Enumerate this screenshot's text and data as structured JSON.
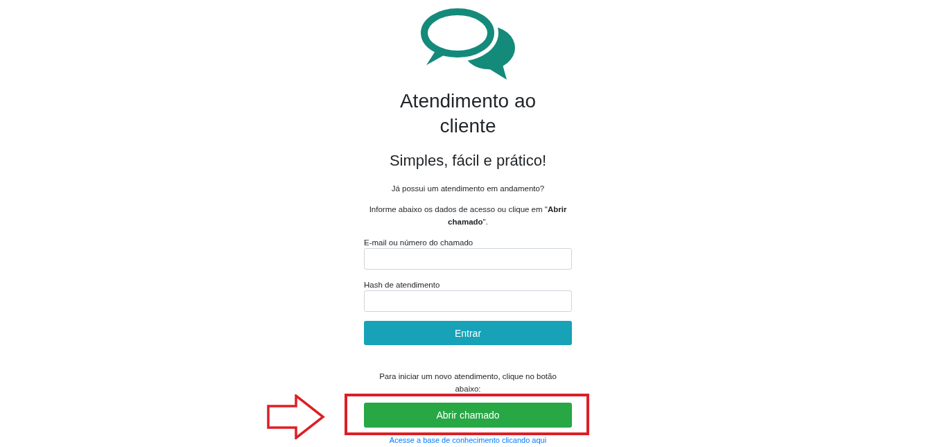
{
  "header": {
    "title": "Atendimento ao cliente",
    "subtitle": "Simples, fácil e prático!"
  },
  "login": {
    "question": "Já possui um atendimento em andamento?",
    "instructions": "Informe abaixo os dados de acesso ou clique em \"**Abrir chamado**\".",
    "fields": [
      {
        "label": "E-mail ou número do chamado"
      },
      {
        "label": "Hash de atendimento"
      }
    ],
    "submit": "Entrar"
  },
  "new_ticket": {
    "prompt": "Para iniciar um novo atendimento, clique no botão abaixo:",
    "button": "Abrir chamado",
    "highlighted": true
  },
  "knowledge_base_link": "Acesse a base de conhecimento clicando aqui"
}
